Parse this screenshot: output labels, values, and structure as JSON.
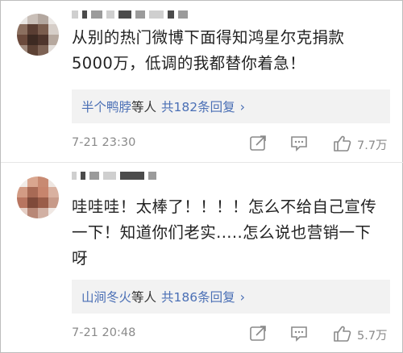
{
  "comments": [
    {
      "text_line1": "从别的热门微博下面得知鸿星尔克捐款",
      "text_line2": "5000万，低调的我都替你着急！",
      "reply_name": "半个鸭脖",
      "reply_who": "等人",
      "reply_count": "共182条回复",
      "reply_chevron": "›",
      "time": "7-21 23:30",
      "likes": "7.7万"
    },
    {
      "text_line1": "哇哇哇！太棒了！！！！怎么不给自己宣传",
      "text_line2": "一下！知道你们老实.....怎么说也营销一下",
      "text_line3": "呀",
      "reply_name": "山涧冬火",
      "reply_who": "等人",
      "reply_count": "共186条回复",
      "reply_chevron": "›",
      "time": "7-21 20:48",
      "likes": "5.7万"
    }
  ],
  "icons": {
    "share": "share-icon",
    "comment": "comment-icon",
    "like": "thumbs-up-icon"
  },
  "colors": {
    "link_blue": "#4a6fb5",
    "meta_gray": "#8a8a8a",
    "reply_bg": "#f2f2f2"
  }
}
